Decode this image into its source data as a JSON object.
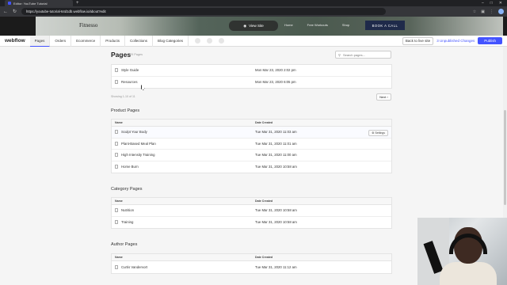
{
  "browser": {
    "tab_title": "Editor: YouTube Tutorial",
    "url": "https://youtube-tutorial-64d1db.webflow.io/about?edit",
    "new_tab": "+",
    "window_controls": [
      "–",
      "□",
      "✕"
    ]
  },
  "site_preview": {
    "brand": "Fitnesso",
    "view_site": "View Site",
    "nav": [
      "Home",
      "Free Workouts",
      "Shop"
    ],
    "cta": "BOOK A CALL"
  },
  "designer_bar": {
    "logo": "webflow",
    "tabs": [
      "Pages",
      "Orders",
      "Ecommerce",
      "Products",
      "Collections",
      "Blog Categories"
    ],
    "active_tab": "Pages",
    "back_button": "Back to live site",
    "unpublished": "3 Unpublished Changes",
    "publish": "Publish",
    "accent_color": "#4353ff"
  },
  "pages": {
    "title": "Pages",
    "count": "29 Pages",
    "search_placeholder": "Search pages...",
    "static_rows": [
      {
        "name": "Style Guide",
        "date": "Mon Mar 23, 2020 2:02 pm"
      },
      {
        "name": "Resources",
        "date": "Mon Mar 23, 2020 6:05 pm"
      }
    ],
    "showing": "Showing 1-10 of 11",
    "next": "Next ›"
  },
  "columns": {
    "name": "Name",
    "date": "Date Created"
  },
  "product_pages": {
    "title": "Product Pages",
    "rows": [
      {
        "name": "Sculpt Your Body",
        "date": "Tue Mar 31, 2020 11:03 am"
      },
      {
        "name": "Plant-Based Meal Plan",
        "date": "Tue Mar 31, 2020 11:01 am"
      },
      {
        "name": "High Intensity Training",
        "date": "Tue Mar 31, 2020 11:00 am"
      },
      {
        "name": "Home Burn",
        "date": "Tue Mar 31, 2020 10:58 am"
      }
    ],
    "settings_label": "Settings"
  },
  "category_pages": {
    "title": "Category Pages",
    "rows": [
      {
        "name": "Nutrition",
        "date": "Tue Mar 31, 2020 10:58 am"
      },
      {
        "name": "Training",
        "date": "Tue Mar 31, 2020 10:58 am"
      }
    ]
  },
  "author_pages": {
    "title": "Author Pages",
    "rows": [
      {
        "name": "Curtis Vandervort",
        "date": "Tue Mar 31, 2020 11:12 am"
      }
    ]
  }
}
